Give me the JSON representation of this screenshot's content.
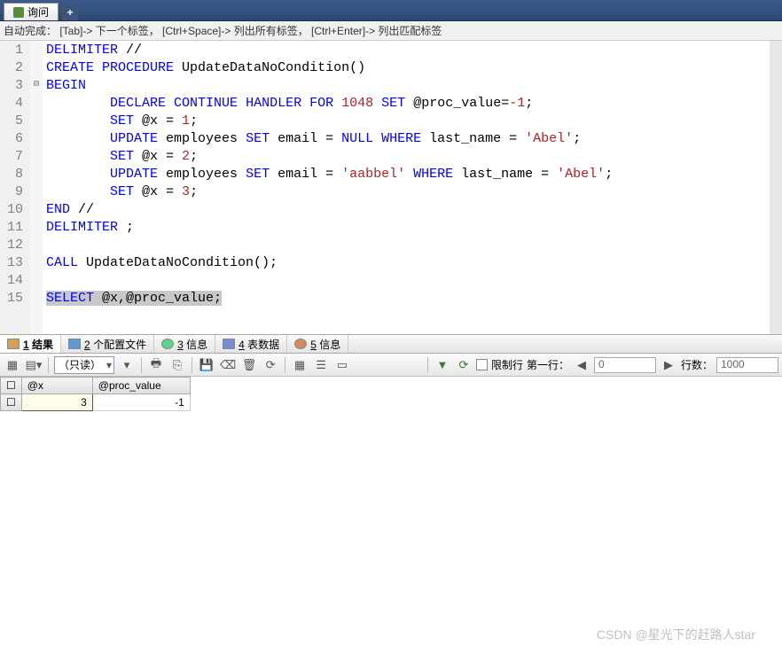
{
  "tabbar": {
    "tab1": "询问",
    "newtab": "+"
  },
  "autocomplete": "自动完成： [Tab]-> 下一个标签， [Ctrl+Space]-> 列出所有标签， [Ctrl+Enter]-> 列出匹配标签",
  "lines": [
    "1",
    "2",
    "3",
    "4",
    "5",
    "6",
    "7",
    "8",
    "9",
    "10",
    "11",
    "12",
    "13",
    "14",
    "15"
  ],
  "code": {
    "l1_kw1": "DELIMITER",
    "l1_t": " //",
    "l2_kw1": "CREATE",
    "l2_kw2": "PROCEDURE",
    "l2_id": " UpdateDataNoCondition()",
    "l3_kw": "BEGIN",
    "l4_kw1": "DECLARE",
    "l4_kw2": "CONTINUE",
    "l4_kw3": "HANDLER",
    "l4_kw4": "FOR",
    "l4_n": "1048",
    "l4_kw5": "SET",
    "l4_t": " @proc_value=",
    "l4_n2": "-1",
    "l4_sc": ";",
    "l5_kw": "SET",
    "l5_t": " @x = ",
    "l5_n": "1",
    "l5_sc": ";",
    "l6_kw1": "UPDATE",
    "l6_t1": " employees ",
    "l6_kw2": "SET",
    "l6_t2": " email = ",
    "l6_kw3": "NULL",
    "l6_kw4": "WHERE",
    "l6_t3": " last_name = ",
    "l6_s": "'Abel'",
    "l6_sc": ";",
    "l7_kw": "SET",
    "l7_t": " @x = ",
    "l7_n": "2",
    "l7_sc": ";",
    "l8_kw1": "UPDATE",
    "l8_t1": " employees ",
    "l8_kw2": "SET",
    "l8_t2": " email = ",
    "l8_s1": "'aabbel'",
    "l8_kw3": "WHERE",
    "l8_t3": " last_name = ",
    "l8_s2": "'Abel'",
    "l8_sc": ";",
    "l9_kw": "SET",
    "l9_t": " @x = ",
    "l9_n": "3",
    "l9_sc": ";",
    "l10_kw": "END",
    "l10_t": " //",
    "l11_kw": "DELIMITER",
    "l11_t": " ;",
    "l13_kw": "CALL",
    "l13_t": " UpdateDataNoCondition();",
    "l15_kw": "SELECT",
    "l15_t": " @x,@proc_value;"
  },
  "resulttabs": {
    "r1_n": "1",
    "r1_l": "结果",
    "r2_n": "2",
    "r2_l": "个配置文件",
    "r3_n": "3",
    "r3_l": "信息",
    "r4_n": "4",
    "r4_l": "表数据",
    "r5_n": "5",
    "r5_l": "信息"
  },
  "toolbar2": {
    "readonly": "（只读）",
    "limit": "限制行",
    "firstrow": "第一行：",
    "firstval": "0",
    "rows": "行数：",
    "rowsval": "1000"
  },
  "grid": {
    "h1": "@x",
    "h2": "@proc_value",
    "v1": "3",
    "v2": "-1"
  },
  "watermark": "CSDN @星光下的赶路人star"
}
